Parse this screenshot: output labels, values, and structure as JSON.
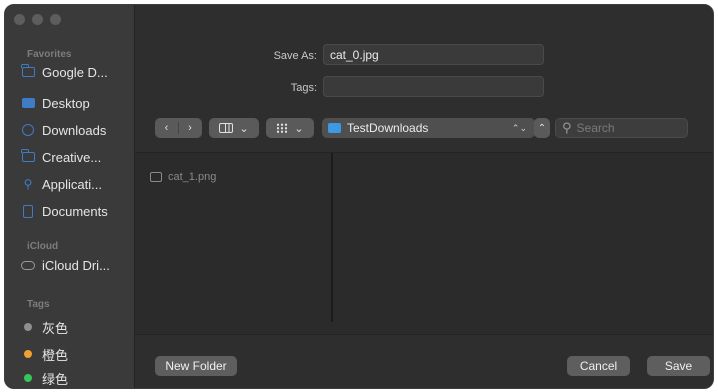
{
  "sidebar": {
    "traffic_lights": [
      "close",
      "minimize",
      "zoom"
    ],
    "favorites_header": "Favorites",
    "favorites": [
      {
        "label": "Google D...",
        "icon": "folder-icon"
      },
      {
        "label": "Desktop",
        "icon": "desktop-icon"
      },
      {
        "label": "Downloads",
        "icon": "downloads-icon"
      },
      {
        "label": "Creative...",
        "icon": "folder-icon"
      },
      {
        "label": "Applicati...",
        "icon": "applications-icon"
      },
      {
        "label": "Documents",
        "icon": "document-icon"
      }
    ],
    "icloud_header": "iCloud",
    "icloud": [
      {
        "label": "iCloud Dri...",
        "icon": "cloud-icon"
      }
    ],
    "tags_header": "Tags",
    "tags": [
      {
        "label": "灰色",
        "color": "#8e8e93"
      },
      {
        "label": "橙色",
        "color": "#f0a030"
      },
      {
        "label": "绿色",
        "color": "#34c759"
      }
    ]
  },
  "save_as": {
    "label": "Save As:",
    "value": "cat_0.jpg"
  },
  "tags_field": {
    "label": "Tags:",
    "value": ""
  },
  "toolbar": {
    "back": "‹",
    "forward": "›",
    "view_columns_chevron": "⌄",
    "view_grid_chevron": "⌄",
    "location": "TestDownloads",
    "location_arrows": "⌃⌄",
    "expand": "⌃",
    "search_placeholder": "Search",
    "search_glyph": "⚲"
  },
  "files": [
    {
      "name": "cat_1.png",
      "icon": "image-file-icon"
    }
  ],
  "buttons": {
    "new_folder": "New Folder",
    "cancel": "Cancel",
    "save": "Save"
  }
}
